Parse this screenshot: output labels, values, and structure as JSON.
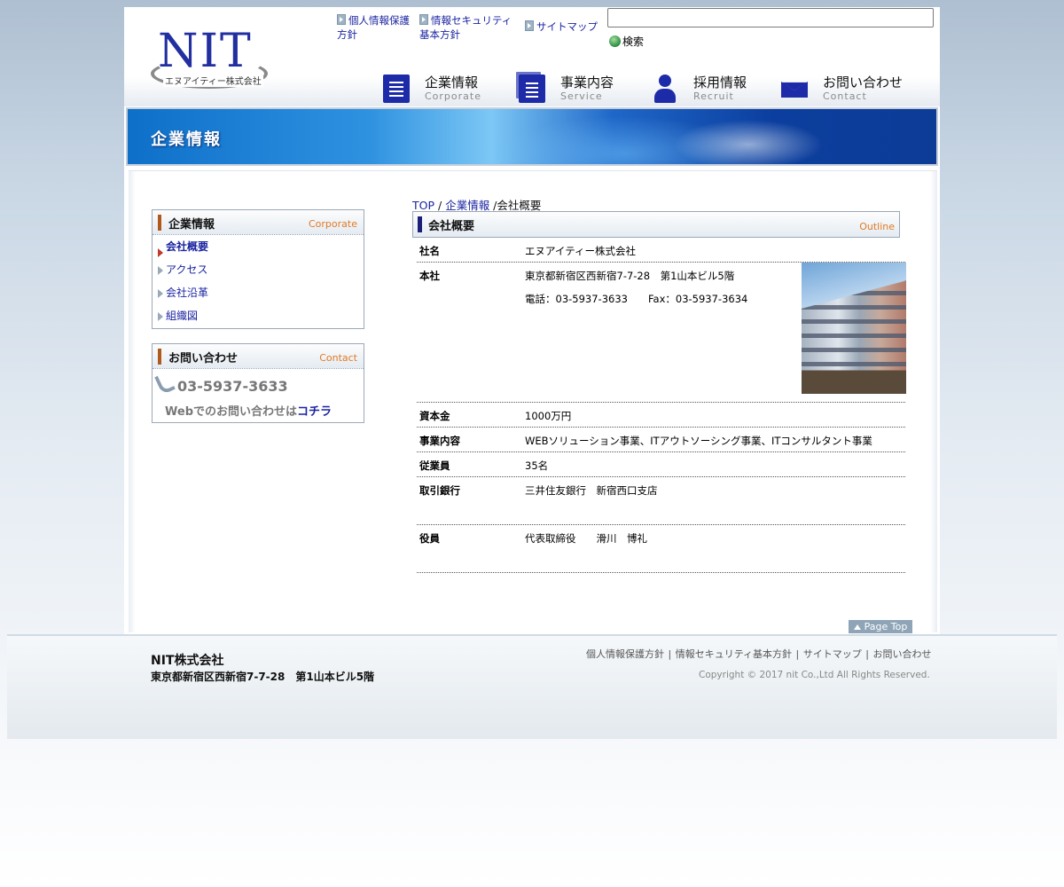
{
  "header": {
    "logo": {
      "mark": "NIT",
      "sub": "エヌアイティー株式会社"
    },
    "top_links": [
      "個人情報保護方針",
      "情報セキュリティ基本方針",
      "サイトマップ"
    ],
    "search": {
      "button_label": "検索",
      "placeholder": ""
    },
    "nav": [
      {
        "jp": "企業情報",
        "en": "Corporate",
        "icon": "document-icon"
      },
      {
        "jp": "事業内容",
        "en": "Service",
        "icon": "documents-icon"
      },
      {
        "jp": "採用情報",
        "en": "Recruit",
        "icon": "person-icon"
      },
      {
        "jp": "お問い合わせ",
        "en": "Contact",
        "icon": "mail-icon"
      }
    ]
  },
  "banner": {
    "title": "企業情報"
  },
  "sidebar": {
    "corporate": {
      "title": "企業情報",
      "title_en": "Corporate",
      "items": [
        "会社概要",
        "アクセス",
        "会社沿革",
        "組織図"
      ]
    },
    "contact": {
      "title": "お問い合わせ",
      "title_en": "Contact",
      "phone": "03-5937-3633",
      "web_text": "Webでのお問い合わせは",
      "web_link": "コチラ"
    }
  },
  "breadcrumb": {
    "top": "TOP",
    "sep": " / ",
    "section": "企業情報",
    "current": " /会社概要"
  },
  "outline": {
    "title": "会社概要",
    "title_en": "Outline",
    "rows": [
      {
        "key": "社名",
        "value": "エヌアイティー株式会社"
      },
      {
        "key": "本社",
        "value": "東京都新宿区西新宿7-7-28　第1山本ビル5階",
        "value2": "電話：03-5937-3633　　Fax：03-5937-3634"
      },
      {
        "key": "資本金",
        "value": "1000万円"
      },
      {
        "key": "事業内容",
        "value": "WEBソリューション事業、ITアウトソーシング事業、ITコンサルタント事業"
      },
      {
        "key": "従業員",
        "value": "35名"
      },
      {
        "key": "取引銀行",
        "value": "三井住友銀行　新宿西口支店"
      },
      {
        "key": "役員",
        "value": "代表取締役　　滑川　博礼"
      }
    ]
  },
  "page_top": "Page Top",
  "footer": {
    "company": "NIT株式会社",
    "address": "東京都新宿区西新宿7-7-28　第1山本ビル5階",
    "links": [
      "個人情報保護方針",
      "情報セキュリティ基本方針",
      "サイトマップ",
      "お問い合わせ"
    ],
    "copyright": "Copyright © 2017 nit Co.,Ltd All Rights Reserved."
  },
  "colors": {
    "link": "#1a23a0",
    "accent_orange": "#e27a25",
    "nav_icon": "#1d2ba8",
    "banner": "#1f67c8"
  }
}
